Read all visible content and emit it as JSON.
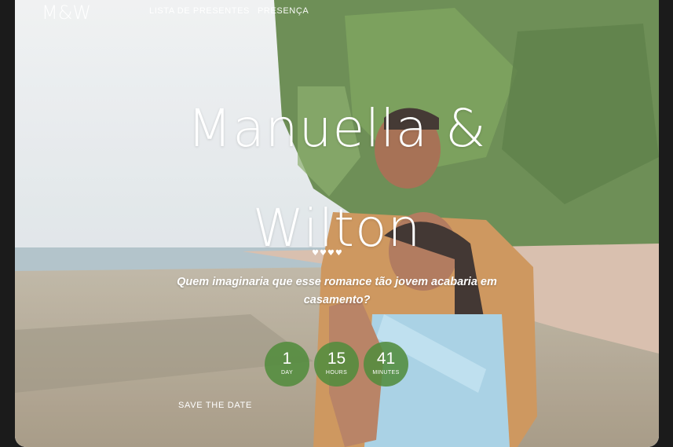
{
  "nav": {
    "logo": "M&W",
    "links": [
      "LISTA DE PRESENTES",
      "PRESENÇA"
    ]
  },
  "hero": {
    "title_line1": "Manuella &",
    "title_line2": "Wilton",
    "hearts": "♥♥♥♥",
    "tagline": "Quem imaginaria que esse romance tão jovem acabaria em casamento?"
  },
  "countdown": [
    {
      "value": "1",
      "unit": "DAY"
    },
    {
      "value": "15",
      "unit": "HOURS"
    },
    {
      "value": "41",
      "unit": "MINUTES"
    }
  ],
  "cta": {
    "save_the_date": "SAVE THE DATE"
  },
  "colors": {
    "countdown_bg": "#528c3d",
    "text": "#ffffff"
  }
}
